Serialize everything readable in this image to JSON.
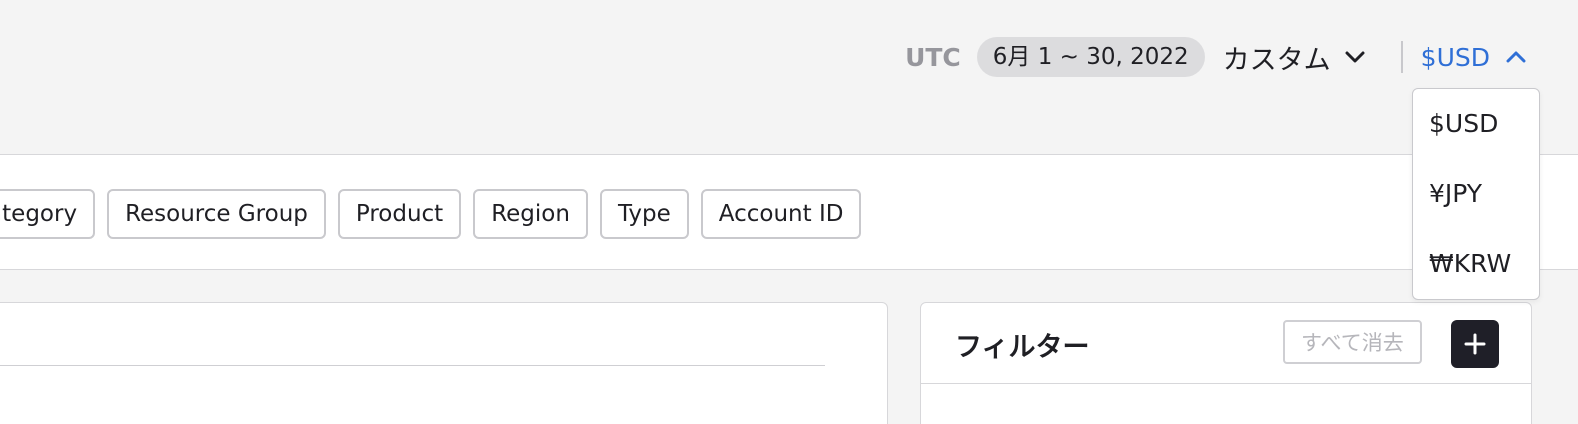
{
  "header": {
    "timezone": "UTC",
    "date_range": "6月 1 ~ 30, 2022",
    "range_type": "カスタム",
    "currency": "$USD"
  },
  "currency_menu": {
    "options": [
      "$USD",
      "¥JPY",
      "₩KRW"
    ]
  },
  "group_by": {
    "chips": [
      "Category",
      "Resource Group",
      "Product",
      "Region",
      "Type",
      "Account ID"
    ]
  },
  "filter_panel": {
    "title": "フィルター",
    "clear_all_label": "すべて消去",
    "add_icon": "plus-icon"
  },
  "colors": {
    "accent": "#2f6fd6",
    "dark_button": "#1f1f28",
    "background": "#f4f4f4"
  }
}
